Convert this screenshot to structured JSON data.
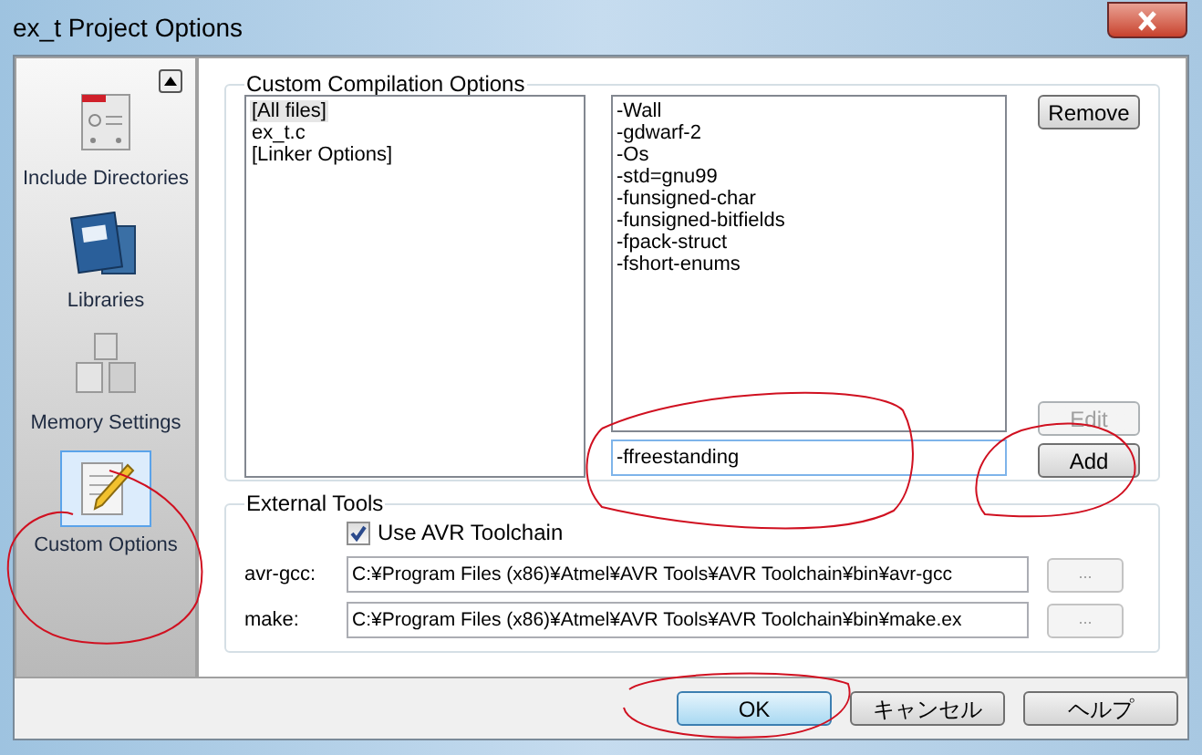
{
  "window": {
    "title": "ex_t Project Options"
  },
  "sidebar": {
    "items": [
      {
        "kind": "include",
        "label": "Include Directories",
        "selected": false
      },
      {
        "kind": "libraries",
        "label": "Libraries",
        "selected": false
      },
      {
        "kind": "memory",
        "label": "Memory Settings",
        "selected": false
      },
      {
        "kind": "custom",
        "label": "Custom Options",
        "selected": true
      }
    ]
  },
  "custom_compilation_options": {
    "title": "Custom Compilation Options",
    "files": [
      {
        "label": "[All files]",
        "selected": true
      },
      {
        "label": "ex_t.c",
        "selected": false
      },
      {
        "label": "[Linker Options]",
        "selected": false
      }
    ],
    "options": [
      "-Wall",
      "-gdwarf-2",
      "-Os",
      "-std=gnu99",
      "-funsigned-char",
      "-funsigned-bitfields",
      "-fpack-struct",
      "-fshort-enums"
    ],
    "new_option": {
      "value": "-ffreestanding"
    },
    "buttons": [
      {
        "label": "Remove",
        "disabled": false
      },
      {
        "label": "Edit",
        "disabled": true
      },
      {
        "label": "Add",
        "disabled": false
      }
    ]
  },
  "external_tools": {
    "title": "External Tools",
    "use_toolchain": {
      "label": "Use AVR Toolchain",
      "checked": true
    },
    "tools": [
      {
        "label": "avr-gcc:",
        "path": "C:¥Program Files (x86)¥Atmel¥AVR Tools¥AVR Toolchain¥bin¥avr-gcc",
        "browse": "...",
        "disabled": true
      },
      {
        "label": "make:",
        "path": "C:¥Program Files (x86)¥Atmel¥AVR Tools¥AVR Toolchain¥bin¥make.ex",
        "browse": "...",
        "disabled": true
      }
    ]
  },
  "buttons": [
    {
      "label": "OK",
      "default": true
    },
    {
      "label": "キャンセル",
      "default": false
    },
    {
      "label": "ヘルプ",
      "default": false
    }
  ]
}
